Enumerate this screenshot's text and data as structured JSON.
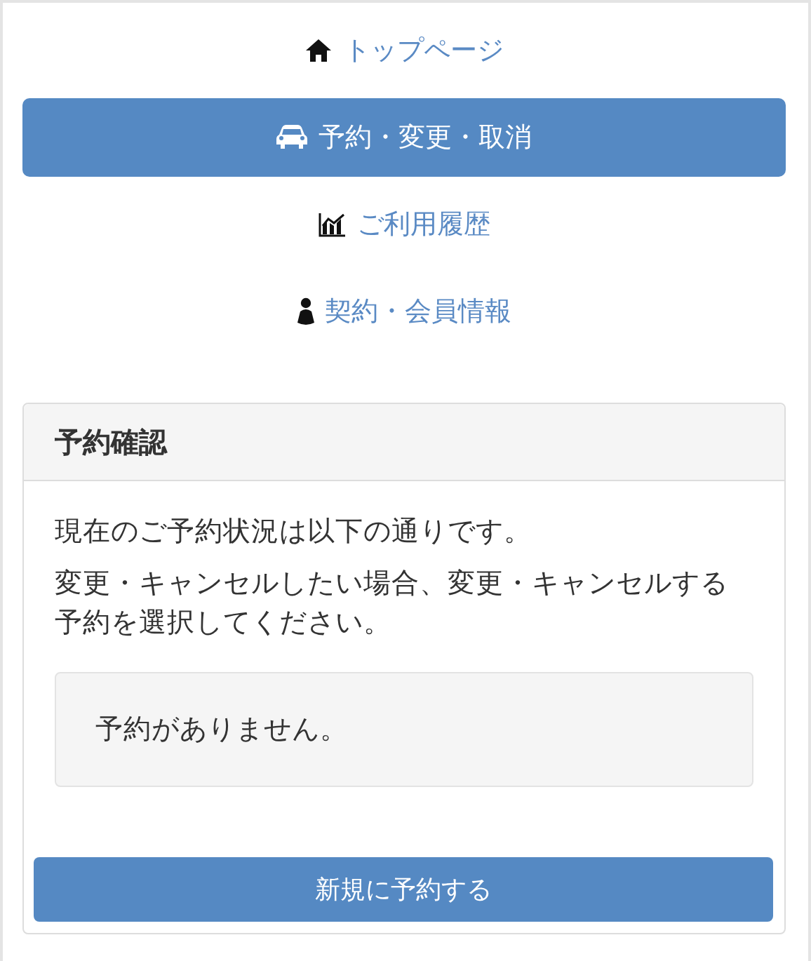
{
  "nav": [
    {
      "label": "トップページ",
      "selected": false
    },
    {
      "label": "予約・変更・取消",
      "selected": true
    },
    {
      "label": "ご利用履歴",
      "selected": false
    },
    {
      "label": "契約・会員情報",
      "selected": false
    }
  ],
  "panel": {
    "title": "予約確認",
    "paragraphs": [
      "現在のご予約状況は以下の通りです。",
      "変更・キャンセルしたい場合、変更・キャンセルする予約を選択してください。"
    ],
    "notice": "予約がありません。",
    "button": "新規に予約する"
  }
}
